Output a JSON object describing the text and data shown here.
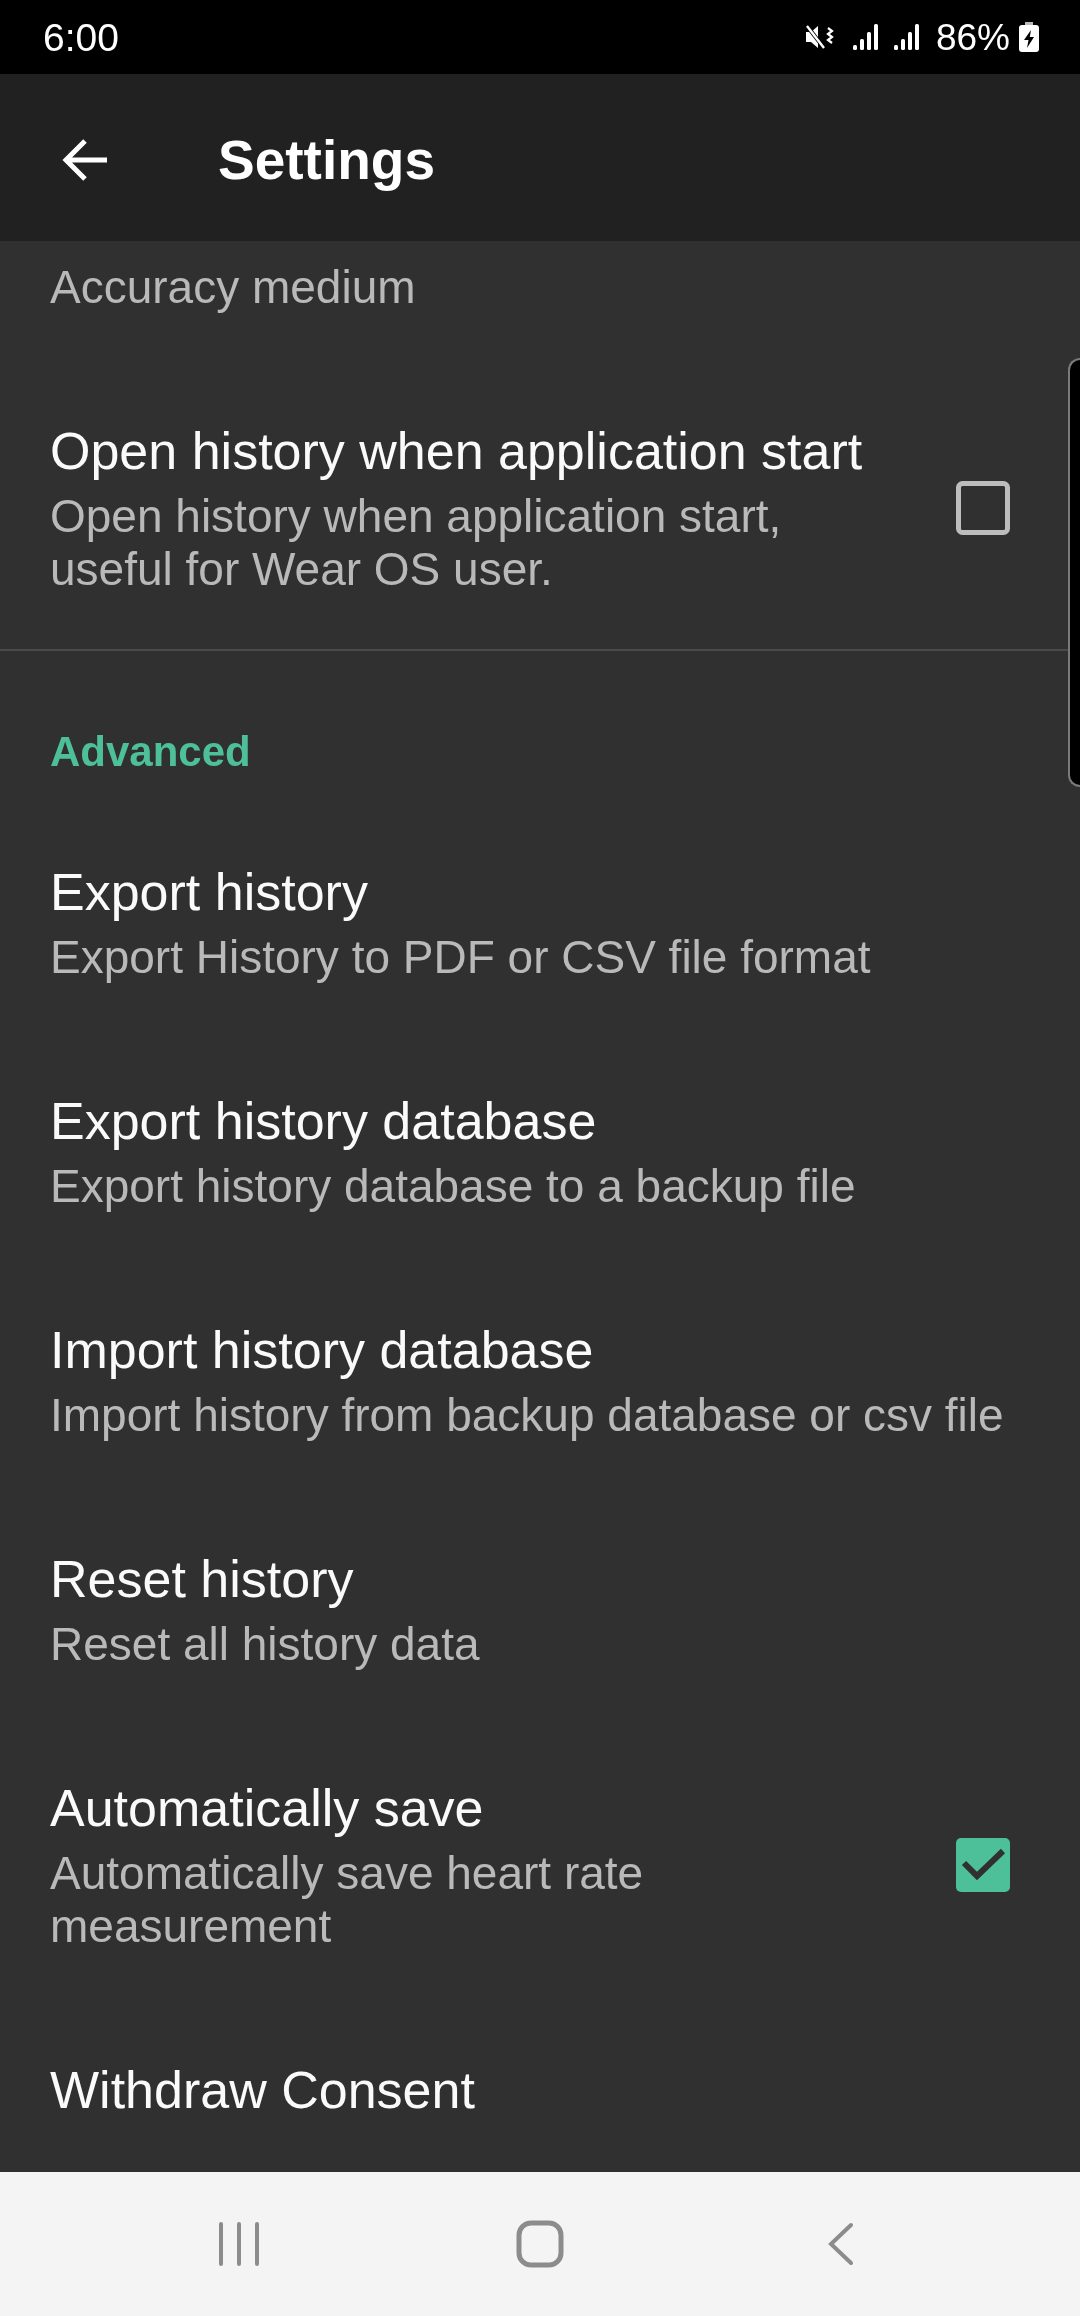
{
  "status_bar": {
    "time": "6:00",
    "battery": "86%"
  },
  "app_bar": {
    "title": "Settings"
  },
  "sections": [
    {
      "items": [
        {
          "kind": "text",
          "summary": "Accuracy medium"
        },
        {
          "kind": "checkbox",
          "title": "Open history when application start",
          "summary": "Open history when application start, useful for Wear OS user.",
          "checked": false
        }
      ]
    },
    {
      "category": "Advanced",
      "items": [
        {
          "kind": "text",
          "title": "Export history",
          "summary": "Export History to PDF or CSV file format"
        },
        {
          "kind": "text",
          "title": "Export history database",
          "summary": "Export history database to a backup file"
        },
        {
          "kind": "text",
          "title": "Import history database",
          "summary": "Import history from backup database or csv file"
        },
        {
          "kind": "text",
          "title": "Reset history",
          "summary": "Reset all history data"
        },
        {
          "kind": "checkbox",
          "title": "Automatically save",
          "summary": "Automatically save heart rate measurement",
          "checked": true
        },
        {
          "kind": "text",
          "title": "Withdraw Consent"
        }
      ]
    }
  ]
}
